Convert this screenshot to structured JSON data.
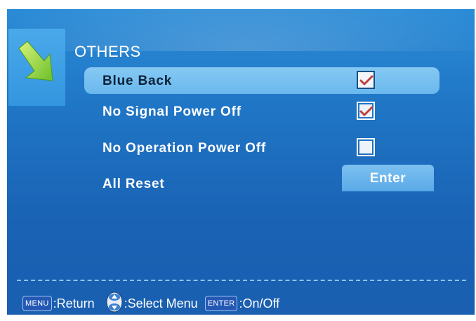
{
  "menu": {
    "title": "OTHERS",
    "icon": "arrow-down-right-icon",
    "items": [
      {
        "label": "Blue Back",
        "type": "checkbox",
        "checked": true,
        "selected": true
      },
      {
        "label": "No Signal Power Off",
        "type": "checkbox",
        "checked": true,
        "selected": false
      },
      {
        "label": "No Operation Power Off",
        "type": "checkbox",
        "checked": false,
        "selected": false
      },
      {
        "label": "All Reset",
        "type": "button",
        "button_label": "Enter",
        "selected": false
      }
    ]
  },
  "footer": {
    "menu_key": "MENU",
    "menu_hint": ":Return",
    "nav_icon": "up-down-arrows-icon",
    "nav_hint": ":Select Menu",
    "enter_key": "ENTER",
    "enter_hint": ":On/Off"
  },
  "colors": {
    "background": "#1f74c4",
    "highlight": "#78c0f1",
    "check_mark": "#c0423a",
    "key_bg": "#2458b4"
  }
}
